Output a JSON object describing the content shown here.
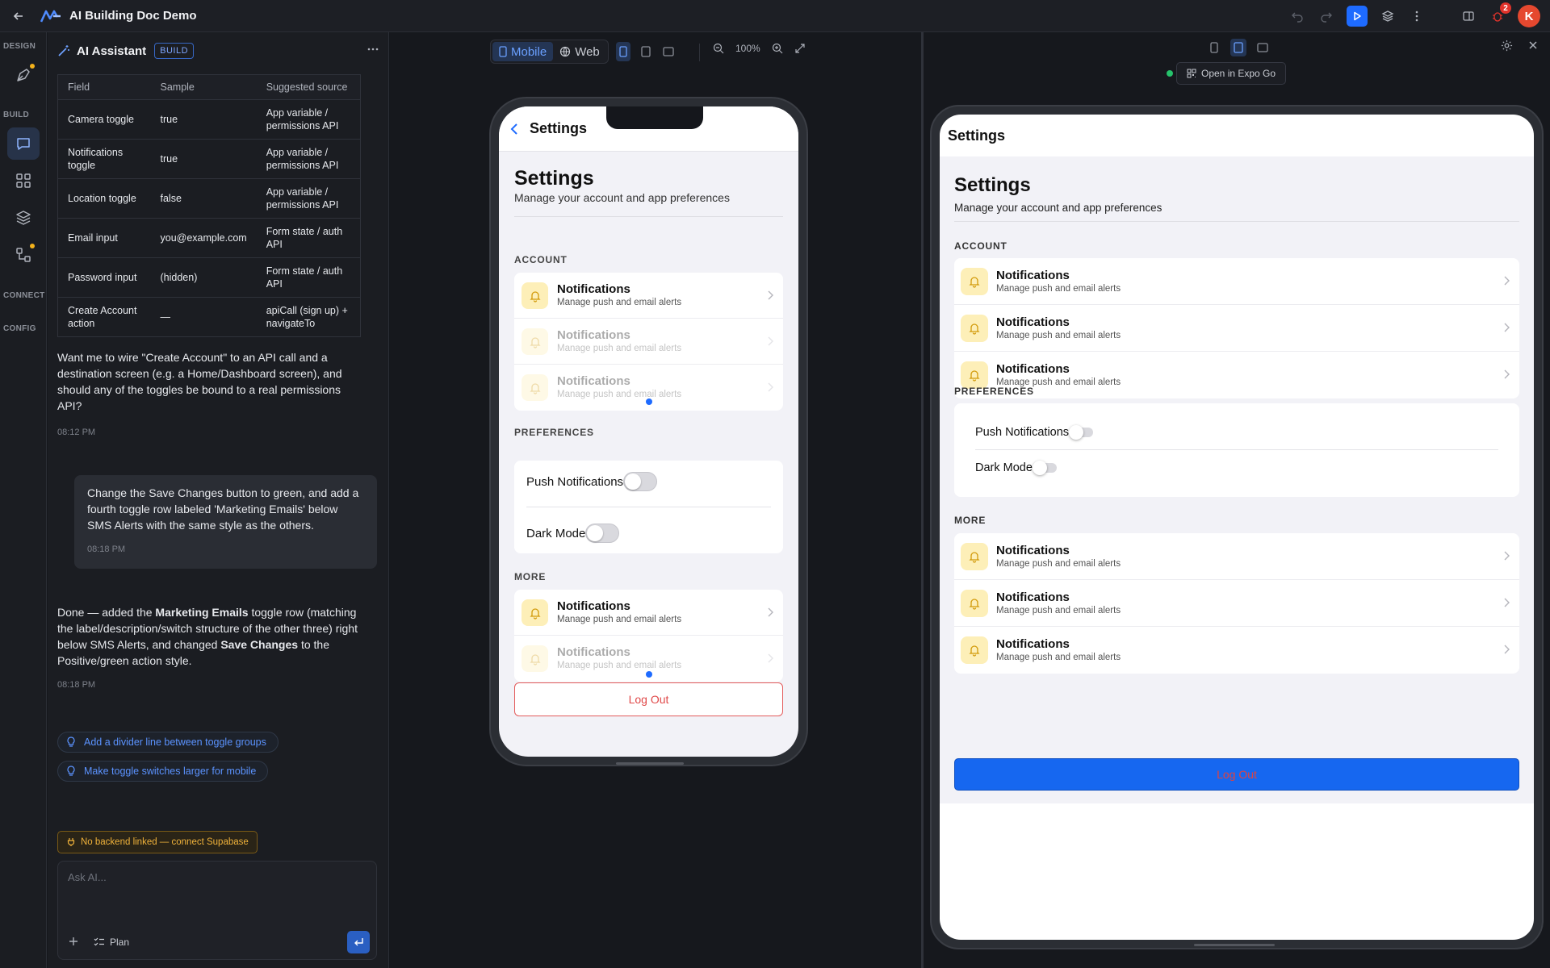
{
  "app": {
    "title": "AI Building Doc Demo",
    "avatar_initial": "K",
    "notifications_count": "2"
  },
  "rail": {
    "design": "DESIGN",
    "build": "BUILD",
    "connect": "CONNECT",
    "config": "CONFIG"
  },
  "assistant": {
    "title": "AI Assistant",
    "badge": "BUILD",
    "table": {
      "headers": [
        "Field",
        "Sample",
        "Suggested source"
      ],
      "rows": [
        [
          "Camera toggle",
          "true",
          "App variable / permissions API"
        ],
        [
          "Notifications toggle",
          "true",
          "App variable / permissions API"
        ],
        [
          "Location toggle",
          "false",
          "App variable / permissions API"
        ],
        [
          "Email input",
          "you@example.com",
          "Form state / auth API"
        ],
        [
          "Password input",
          "(hidden)",
          "Form state / auth API"
        ],
        [
          "Create Account action",
          "—",
          "apiCall (sign up) + navigateTo"
        ]
      ]
    },
    "msg1": "Want me to wire \"Create Account\" to an API call and a destination screen (e.g. a Home/Dashboard screen), and should any of the toggles be bound to a real permissions API?",
    "msg1_time": "08:12 PM",
    "user_msg": "Change the Save Changes button to green, and add a fourth toggle row labeled 'Marketing Emails' below SMS Alerts with the same style as the others.",
    "user_time": "08:18 PM",
    "msg2": {
      "p1": "Done — added the ",
      "b1": "Marketing Emails",
      "p2": " toggle row (matching the label/description/switch structure of the other three) right below SMS Alerts, and changed ",
      "b2": "Save Changes",
      "p3": " to the Positive/green action style."
    },
    "msg2_time": "08:18 PM",
    "suggestions": [
      "Add a divider line between toggle groups",
      "Make toggle switches larger for mobile"
    ],
    "warning": "No backend linked — connect Supabase",
    "input_placeholder": "Ask AI...",
    "plan_label": "Plan"
  },
  "canvas": {
    "mode_mobile": "Mobile",
    "mode_web": "Web",
    "zoom": "100%"
  },
  "phone": {
    "nav_title": "Settings",
    "title": "Settings",
    "subtitle": "Manage your account and app preferences",
    "sec_account": "ACCOUNT",
    "sec_preferences": "PREFERENCES",
    "sec_more": "MORE",
    "row_title": "Notifications",
    "row_sub": "Manage push and email alerts",
    "pref1": "Push Notifications",
    "pref2": "Dark Mode",
    "logout": "Log Out"
  },
  "preview": {
    "expo": "Open in Expo Go",
    "nav_title": "Settings",
    "title": "Settings",
    "subtitle": "Manage your account and app preferences",
    "sec_account": "ACCOUNT",
    "sec_preferences": "PREFERENCES",
    "sec_more": "MORE",
    "row_title": "Notifications",
    "row_sub": "Manage push and email alerts",
    "pref1": "Push Notifications",
    "pref2": "Dark Mode",
    "logout": "Log Out"
  }
}
